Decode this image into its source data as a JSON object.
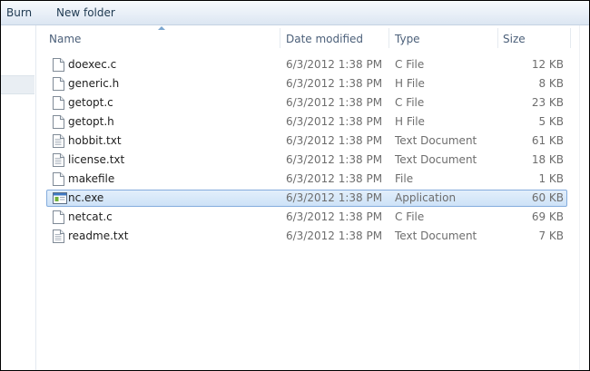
{
  "toolbar": {
    "burn_label": "Burn",
    "new_folder_label": "New folder"
  },
  "columns": {
    "name": "Name",
    "date": "Date modified",
    "type": "Type",
    "size": "Size",
    "sort_icon": "sort-ascending-icon"
  },
  "files": [
    {
      "name": "doexec.c",
      "date": "6/3/2012 1:38 PM",
      "type": "C File",
      "size": "12 KB",
      "icon": "document-icon"
    },
    {
      "name": "generic.h",
      "date": "6/3/2012 1:38 PM",
      "type": "H File",
      "size": "8 KB",
      "icon": "document-icon"
    },
    {
      "name": "getopt.c",
      "date": "6/3/2012 1:38 PM",
      "type": "C File",
      "size": "23 KB",
      "icon": "document-icon"
    },
    {
      "name": "getopt.h",
      "date": "6/3/2012 1:38 PM",
      "type": "H File",
      "size": "5 KB",
      "icon": "document-icon"
    },
    {
      "name": "hobbit.txt",
      "date": "6/3/2012 1:38 PM",
      "type": "Text Document",
      "size": "61 KB",
      "icon": "text-file-icon"
    },
    {
      "name": "license.txt",
      "date": "6/3/2012 1:38 PM",
      "type": "Text Document",
      "size": "18 KB",
      "icon": "text-file-icon"
    },
    {
      "name": "makefile",
      "date": "6/3/2012 1:38 PM",
      "type": "File",
      "size": "1 KB",
      "icon": "document-icon"
    },
    {
      "name": "nc.exe",
      "date": "6/3/2012 1:38 PM",
      "type": "Application",
      "size": "60 KB",
      "icon": "application-icon",
      "selected": true
    },
    {
      "name": "netcat.c",
      "date": "6/3/2012 1:38 PM",
      "type": "C File",
      "size": "69 KB",
      "icon": "document-icon"
    },
    {
      "name": "readme.txt",
      "date": "6/3/2012 1:38 PM",
      "type": "Text Document",
      "size": "7 KB",
      "icon": "text-file-icon"
    }
  ],
  "colors": {
    "selection_border": "#84acdd",
    "header_text": "#4c607a",
    "muted_text": "#6d6d6d"
  }
}
